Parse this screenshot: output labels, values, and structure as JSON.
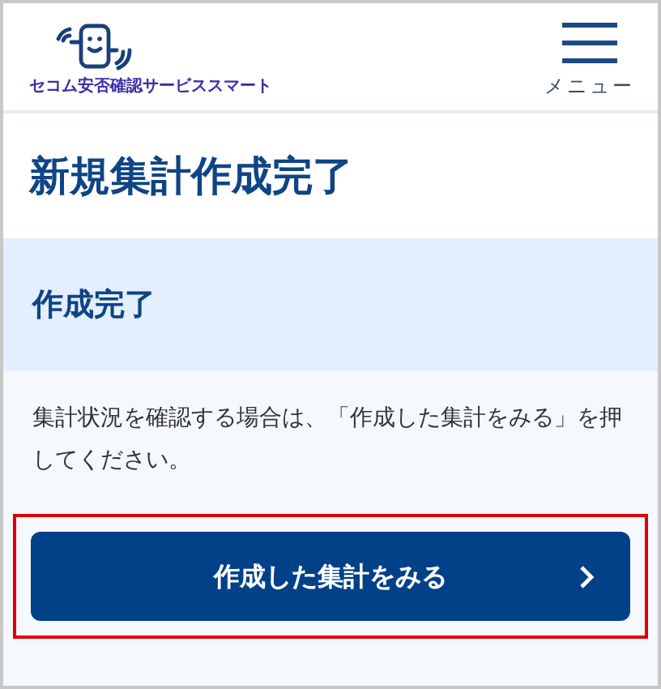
{
  "header": {
    "logo_text": "セコム安否確認サービススマート",
    "menu_label": "メニュー"
  },
  "page_title": "新規集計作成完了",
  "section": {
    "heading": "作成完了",
    "message": "集計状況を確認する場合は、「作成した集計をみる」を押してください。"
  },
  "button": {
    "label": "作成した集計をみる",
    "highlighted": true
  }
}
